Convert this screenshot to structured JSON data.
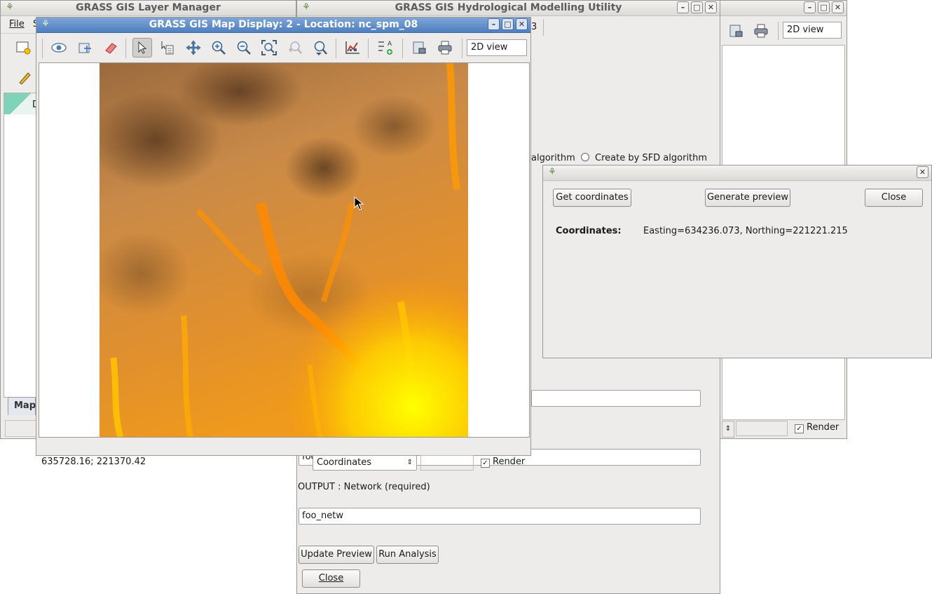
{
  "layer_manager": {
    "title": "GRASS GIS Layer Manager",
    "menu_file": "File",
    "menu_s": "S",
    "tab_d": "D",
    "tab_map": "Map"
  },
  "hydro": {
    "title": "GRASS GIS Hydrological Modelling Utility",
    "tab_fragment": "3",
    "algo_fragment": "algorithm",
    "sfd_label": "Create by SFD algorithm",
    "stream_value": "foo_stre",
    "network_label": "OUTPUT : Network (required)",
    "network_value": "foo_netw",
    "update_preview": "Update Preview",
    "run_analysis": "Run Analysis",
    "close": "Close"
  },
  "bg_display": {
    "view_combo": "2D view",
    "render": "Render"
  },
  "map_display": {
    "title": "GRASS GIS Map Display: 2  - Location: nc_spm_08",
    "view_combo": "2D view",
    "coords_readout": "635728.16; 221370.42",
    "status_combo": "Coordinates",
    "render": "Render",
    "render_checked": true
  },
  "coord_dialog": {
    "get_coordinates": "Get coordinates",
    "generate_preview": "Generate preview",
    "close": "Close",
    "coords_label": "Coordinates:",
    "coords_value": "Easting=634236.073, Northing=221221.215"
  },
  "icons": [
    "grass-icon",
    "add-raster-icon",
    "digitize-icon",
    "show-icon",
    "erase-icon",
    "pointer-icon",
    "query-icon",
    "pan-icon",
    "zoom-in-icon",
    "zoom-out-icon",
    "zoom-extent-icon",
    "zoom-back-icon",
    "zoom-menu-icon",
    "analyze-icon",
    "decorations-icon",
    "save-icon",
    "print-icon",
    "cursor-icon"
  ]
}
